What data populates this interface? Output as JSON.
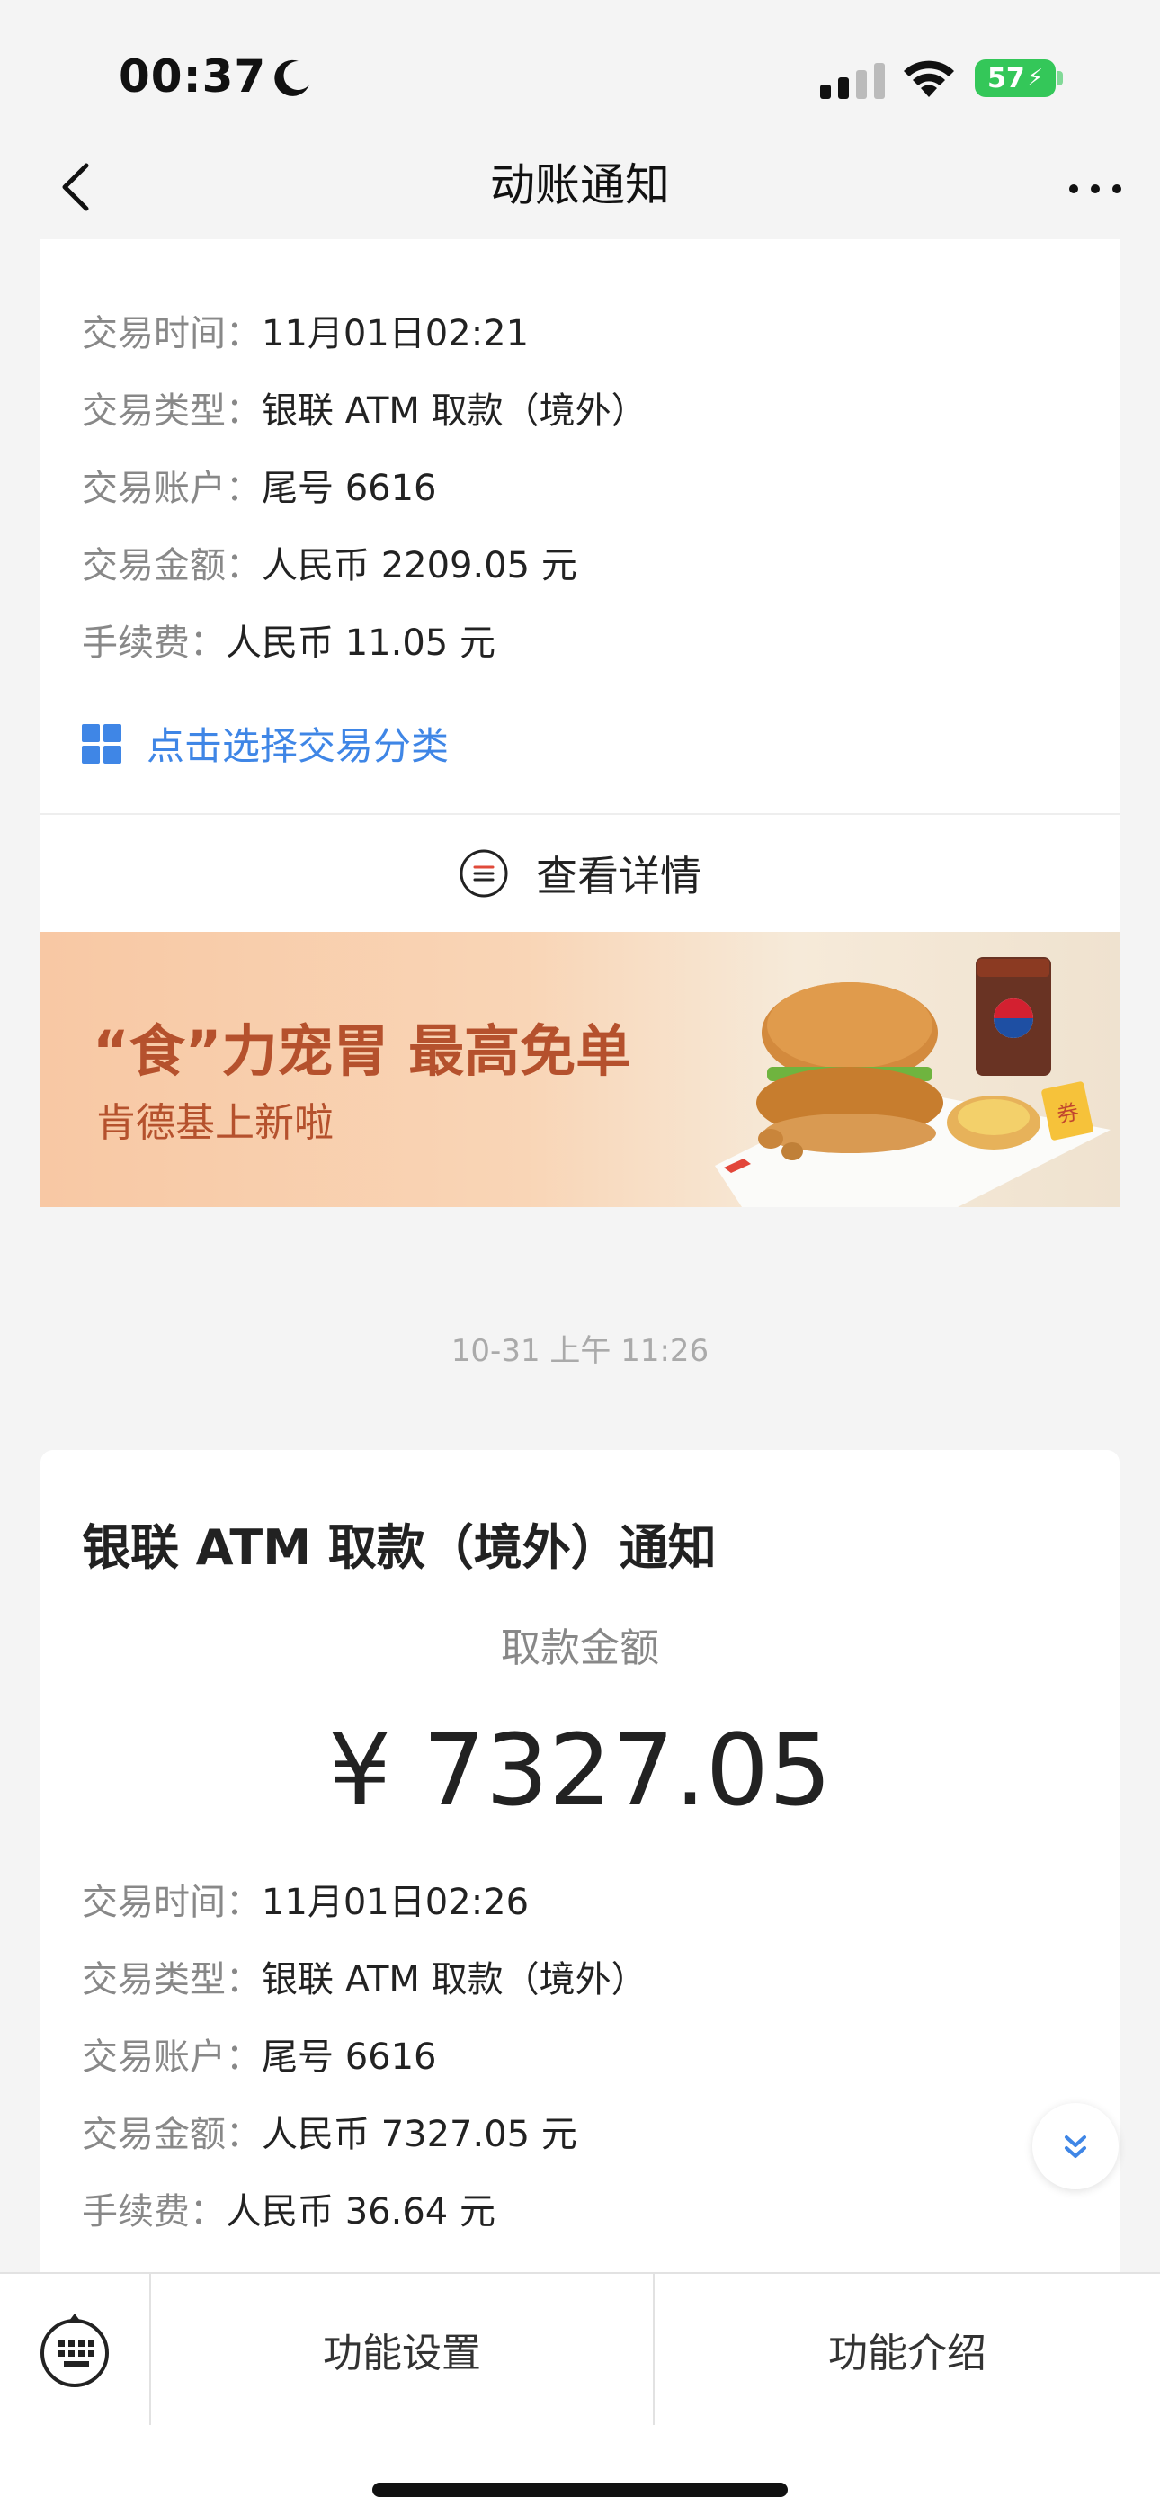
{
  "status_bar": {
    "time": "00:37",
    "battery": "57",
    "icons": [
      "moon-icon",
      "cellular-signal-icon",
      "wifi-icon",
      "battery-icon"
    ]
  },
  "nav": {
    "title": "动账通知",
    "back_icon": "chevron-left-icon",
    "more_icon": "more-dots-icon"
  },
  "card1": {
    "rows": [
      {
        "label": "交易时间：",
        "value": "11月01日02:21"
      },
      {
        "label": "交易类型：",
        "value": "银联 ATM 取款（境外）"
      },
      {
        "label": "交易账户：",
        "value": "尾号 6616"
      },
      {
        "label": "交易金额：",
        "value": "人民币 2209.05 元"
      },
      {
        "label": "手续费：",
        "value": "人民币 11.05 元"
      }
    ],
    "category_label": "点击选择交易分类",
    "details_label": "查看详情"
  },
  "banner": {
    "headline": "“食”力宠胃 最高免单",
    "sub": "肯德基上新啦"
  },
  "timestamp": "10-31 上午 11:26",
  "card2": {
    "title": "银联 ATM 取款（境外）通知",
    "amount_label": "取款金额",
    "amount": "¥ 7327.05",
    "rows": [
      {
        "label": "交易时间：",
        "value": "11月01日02:26"
      },
      {
        "label": "交易类型：",
        "value": "银联 ATM 取款（境外）"
      },
      {
        "label": "交易账户：",
        "value": "尾号 6616"
      },
      {
        "label": "交易金额：",
        "value": "人民币 7327.05 元"
      },
      {
        "label": "手续费：",
        "value": "人民币 36.64 元"
      }
    ]
  },
  "bottom_bar": {
    "keyboard_icon": "keyboard-icon",
    "button1": "功能设置",
    "button2": "功能介绍"
  },
  "colors": {
    "accent": "#3f86e6",
    "background": "#f4f4f4",
    "banner_text": "#b5512d",
    "battery": "#34c759"
  }
}
